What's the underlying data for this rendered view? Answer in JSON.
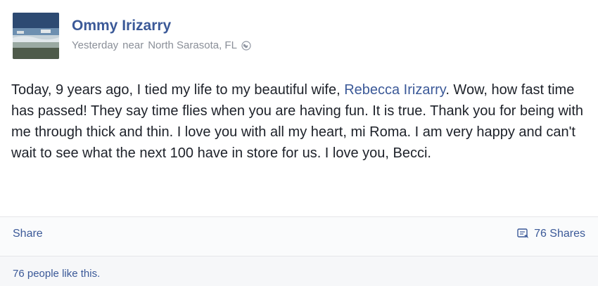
{
  "post": {
    "author": "Ommy Irizarry",
    "timestamp": "Yesterday",
    "location_prefix": "near",
    "location": "North Sarasota, FL",
    "privacy_icon": "globe-icon",
    "body_before_mention": "Today, 9 years ago, I tied my life to my beautiful wife, ",
    "mention": "Rebecca Irizarry",
    "body_after_mention": ". Wow, how fast time has passed! They say time flies when you are having fun. It is true. Thank you for being with me through thick and thin. I love you with all my heart, mi Roma. I am very happy and can't wait to see what the next 100 have in store for us. I love you, Becci."
  },
  "actions": {
    "share_label": "Share",
    "shares_icon": "share-count-icon",
    "shares_count": "76 Shares"
  },
  "likes": {
    "text": "76 people like this."
  },
  "colors": {
    "link": "#3b5998",
    "meta": "#8a8f98",
    "text": "#1d2129",
    "divider": "#e5e6e9"
  }
}
